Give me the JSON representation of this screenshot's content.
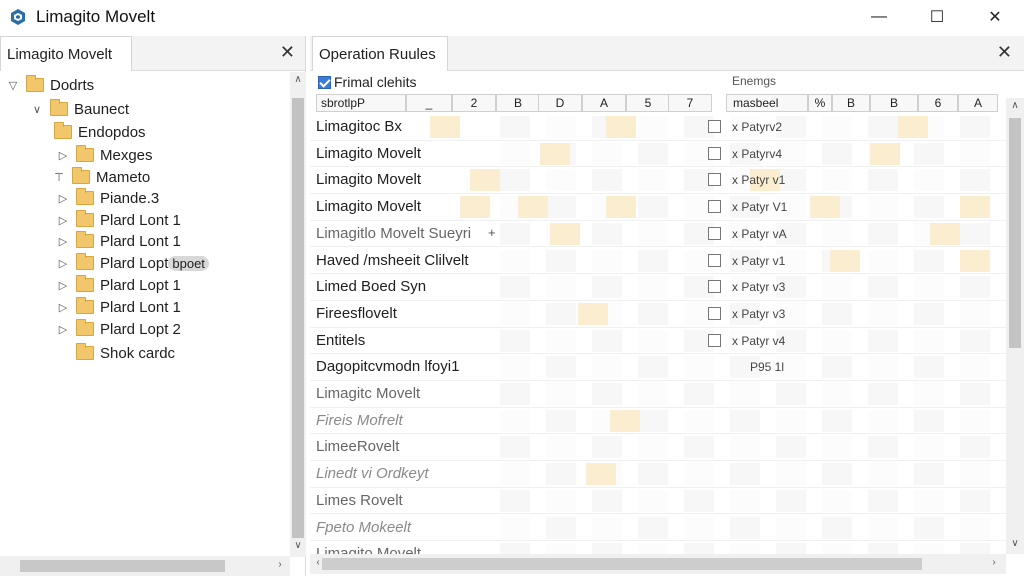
{
  "window": {
    "title": "Limagito Movelt",
    "controls": {
      "minimize": "—",
      "maximize": "☐",
      "close": "✕"
    }
  },
  "left_panel": {
    "tab_label": "Limagito Movelt",
    "close": "✕",
    "tree": [
      {
        "label": "Dodrts",
        "twisty": "▽"
      },
      {
        "label": "Baunect",
        "twisty": "∨"
      },
      {
        "label": "Endopdos",
        "twisty": ""
      },
      {
        "label": "Mexges",
        "twisty": "▷"
      },
      {
        "label": "Mameto",
        "twisty": "⊤"
      },
      {
        "label": "Piande.3",
        "twisty": "▷"
      },
      {
        "label": "Plard Lont 1",
        "twisty": "▷"
      },
      {
        "label": "Plard Lont 1",
        "twisty": "▷"
      },
      {
        "label": "Plard Lopt",
        "twisty": "▷",
        "hover": "bpoet"
      },
      {
        "label": "Plard Lopt 1",
        "twisty": "▷"
      },
      {
        "label": "Plard Lont 1",
        "twisty": "▷"
      },
      {
        "label": "Plard Lopt 2",
        "twisty": "▷"
      },
      {
        "label": "Shok cardc",
        "twisty": ""
      }
    ],
    "scroll_up": "∧",
    "scroll_down": "∨",
    "scroll_right": "›"
  },
  "right_panel": {
    "tab_label": "Operation Ruules",
    "close": "✕",
    "header": {
      "checkbox_label": "Frimal clehits",
      "filter_label": "sbrotlpP",
      "col_headers": [
        "2",
        "B",
        "D",
        "A",
        "5",
        "7"
      ],
      "right_top_label": "Enemgs",
      "right_sub_label": "masbeel",
      "right_col_headers": [
        "%",
        "B",
        "B",
        "6",
        "A"
      ]
    },
    "rows": [
      {
        "label": "Limagitoc Bx",
        "style": "normal",
        "check": "x Patyrv2"
      },
      {
        "label": "Limagito Movelt",
        "style": "normal",
        "check": "x Patyrv4"
      },
      {
        "label": "Limagito Movelt",
        "style": "normal",
        "check": "x Patyr v1"
      },
      {
        "label": "Limagito Movelt",
        "style": "normal",
        "check": "x Patyr V1"
      },
      {
        "label": "Limagitlo Movelt Sueyri",
        "style": "faded",
        "check": "x Patyr vA",
        "plus": "+"
      },
      {
        "label": "Haved /msheeit Clilvelt",
        "style": "normal",
        "check": "x Patyr v1"
      },
      {
        "label": "Limed Boed Syn",
        "style": "normal",
        "check": "x Patyr v3"
      },
      {
        "label": "Fireesflovelt",
        "style": "normal",
        "check": "x Patyr v3"
      },
      {
        "label": "Entitels",
        "style": "normal",
        "check": "x Patyr v4"
      },
      {
        "label": "Dagopitcvmodn lfoyi1",
        "style": "normal",
        "check": "P95 1l"
      },
      {
        "label": "Limagitc Movelt",
        "style": "faded",
        "check": ""
      },
      {
        "label": "Fireis Mofrelt",
        "style": "dim",
        "check": ""
      },
      {
        "label": "LimeeRovelt",
        "style": "faded",
        "check": ""
      },
      {
        "label": "Linedt vi Ordkeyt",
        "style": "dim",
        "check": ""
      },
      {
        "label": "Limes Rovelt",
        "style": "faded",
        "check": ""
      },
      {
        "label": "Fpeto Mokeelt",
        "style": "dim",
        "check": ""
      },
      {
        "label": "Limagito Movelt",
        "style": "faded",
        "check": ""
      }
    ],
    "scroll_up": "∧",
    "scroll_down": "∨",
    "scroll_left": "‹",
    "scroll_right": "›"
  },
  "colors": {
    "accent": "#3a7bd5",
    "cell_highlight": "#fbeed0",
    "folder": "#f2c66b",
    "scrollbar_thumb": "#c4c4c4"
  },
  "icons": {
    "app": "cube-icon",
    "folder": "folder-icon",
    "checkbox": "checkbox-icon"
  }
}
